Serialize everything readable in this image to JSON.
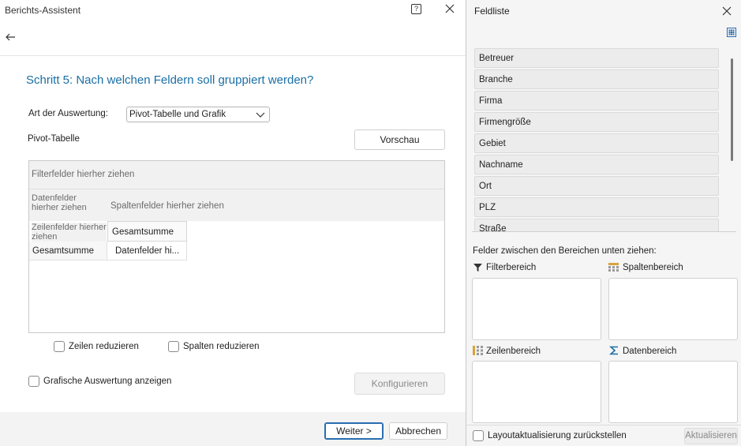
{
  "wizard": {
    "window_title": "Berichts-Assistent",
    "help_glyph": "?",
    "step_title": "Schritt 5: Nach welchen Feldern soll gruppiert werden?",
    "art_label": "Art der Auswertung:",
    "art_value": "Pivot-Tabelle und Grafik",
    "pivot_label": "Pivot-Tabelle",
    "preview_button": "Vorschau",
    "pivot": {
      "filter_drop": "Filterfelder hierher ziehen",
      "data_drop": "Datenfelder hierher ziehen",
      "column_drop": "Spaltenfelder hierher ziehen",
      "row_drop": "Zeilenfelder hierher ziehen",
      "column_total": "Gesamtsumme",
      "row_total": "Gesamtsumme",
      "data_cell": "Datenfelder hi..."
    },
    "reduce_rows_label": "Zeilen reduzieren",
    "reduce_rows_checked": false,
    "reduce_columns_label": "Spalten reduzieren",
    "reduce_columns_checked": false,
    "graphic_label": "Grafische Auswertung anzeigen",
    "graphic_checked": false,
    "configure_button": "Konfigurieren",
    "next_button": "Weiter >",
    "cancel_button": "Abbrechen"
  },
  "fieldlist": {
    "title": "Feldliste",
    "fields": [
      "Betreuer",
      "Branche",
      "Firma",
      "Firmengröße",
      "Gebiet",
      "Nachname",
      "Ort",
      "PLZ",
      "Straße"
    ],
    "drag_hint": "Felder zwischen den Bereichen unten ziehen:",
    "areas": {
      "filter": "Filterbereich",
      "columns": "Spaltenbereich",
      "rows": "Zeilenbereich",
      "data": "Datenbereich"
    },
    "defer_label": "Layoutaktualisierung zurückstellen",
    "defer_checked": false,
    "update_button": "Aktualisieren"
  },
  "colors": {
    "accent": "#1a6fa5",
    "primary_border": "#2a6db0",
    "area_icon": "#d8a33a"
  }
}
